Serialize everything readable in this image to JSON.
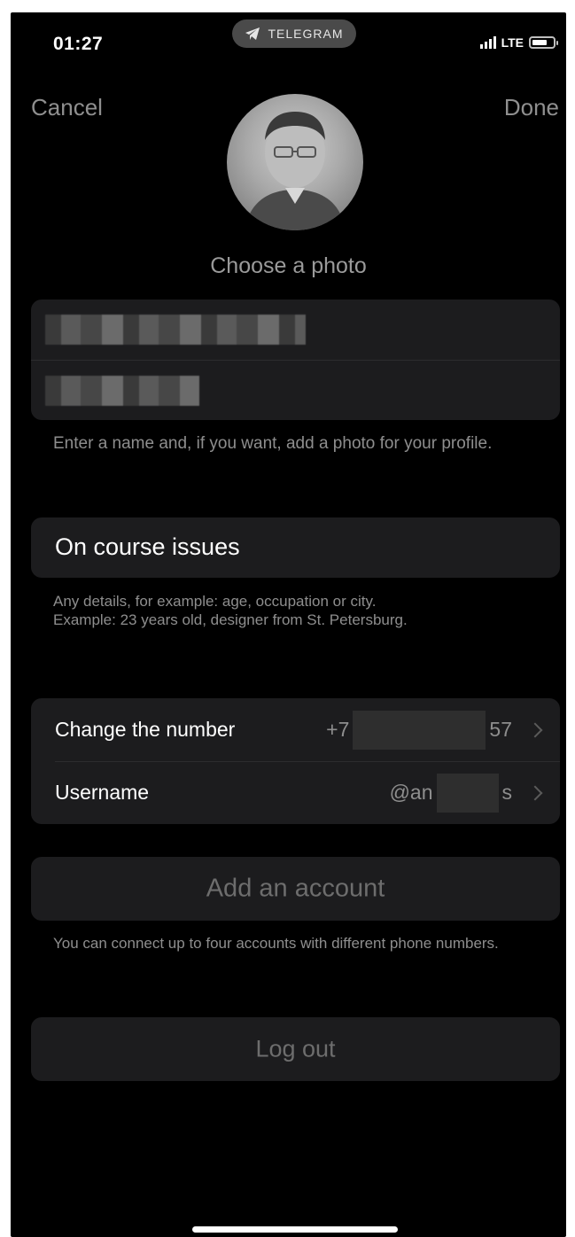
{
  "status_bar": {
    "time": "01:27",
    "app_pill": "TELEGRAM",
    "network": "LTE"
  },
  "nav": {
    "cancel": "Cancel",
    "done": "Done"
  },
  "profile": {
    "choose_photo": "Choose a photo",
    "name_hint": "Enter a name and, if you want, add a photo for your profile."
  },
  "bio": {
    "value": "On course issues",
    "hint_line1": "Any details, for example: age, occupation or city.",
    "hint_line2": "Example: 23 years old, designer from St. Petersburg."
  },
  "account": {
    "change_number_label": "Change the number",
    "phone_prefix": "+7",
    "phone_suffix": "57",
    "username_label": "Username",
    "username_prefix": "@an",
    "username_suffix": "s"
  },
  "actions": {
    "add_account": "Add an account",
    "add_account_hint": "You can connect up to four accounts with different phone numbers.",
    "log_out": "Log out"
  },
  "colors": {
    "background": "#000000",
    "card": "#1c1c1e",
    "secondary_text": "#8e8e8e"
  }
}
